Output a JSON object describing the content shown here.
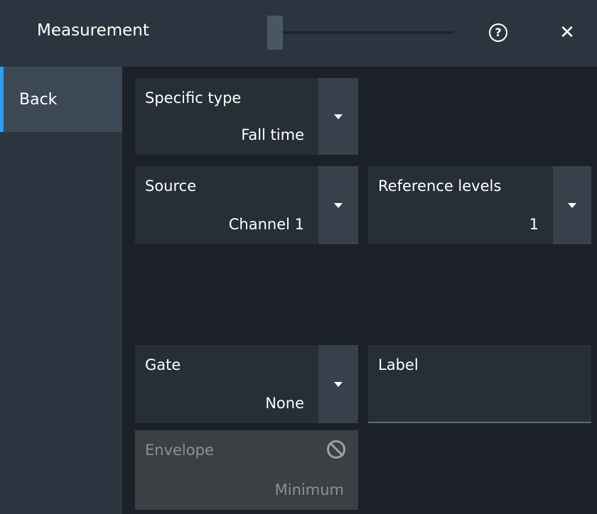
{
  "header": {
    "title": "Measurement",
    "help_icon": "?",
    "close_icon": "✕"
  },
  "sidebar": {
    "items": [
      {
        "label": "Back",
        "active": true
      }
    ]
  },
  "fields": {
    "specific_type": {
      "label": "Specific type",
      "value": "Fall time"
    },
    "source": {
      "label": "Source",
      "value": "Channel 1"
    },
    "reference_levels": {
      "label": "Reference levels",
      "value": "1"
    },
    "gate": {
      "label": "Gate",
      "value": "None"
    },
    "label": {
      "label": "Label",
      "value": ""
    },
    "envelope": {
      "label": "Envelope",
      "value": "Minimum",
      "disabled": true
    }
  },
  "colors": {
    "accent": "#2e9cf2",
    "background": "#1b2127",
    "panel": "#2b353f",
    "field": "#262e36",
    "disabled": "#3c4045"
  },
  "icons": [
    "help-icon",
    "close-icon",
    "dropdown-arrow-icon",
    "disabled-icon"
  ]
}
